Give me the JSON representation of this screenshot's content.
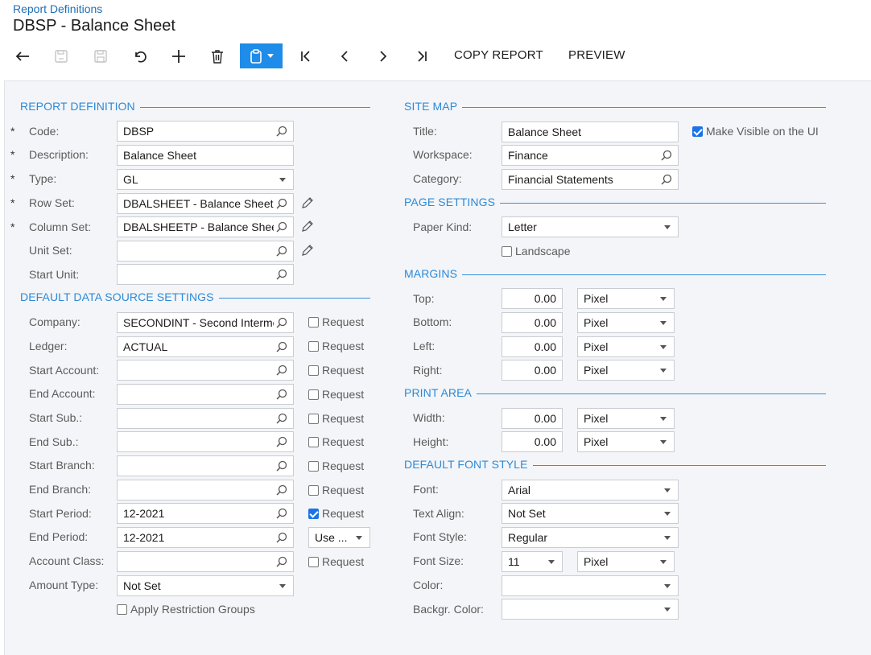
{
  "header": {
    "breadcrumb": "Report Definitions",
    "title": "DBSP - Balance Sheet"
  },
  "toolbar": {
    "copy_report": "COPY REPORT",
    "preview": "PREVIEW"
  },
  "sections": {
    "report_definition": "REPORT DEFINITION",
    "default_data_source": "DEFAULT DATA SOURCE SETTINGS",
    "site_map": "SITE MAP",
    "page_settings": "PAGE SETTINGS",
    "margins": "MARGINS",
    "print_area": "PRINT AREA",
    "default_font_style": "DEFAULT FONT STYLE"
  },
  "report_definition": {
    "code": {
      "label": "Code:",
      "value": "DBSP"
    },
    "description": {
      "label": "Description:",
      "value": "Balance Sheet"
    },
    "type": {
      "label": "Type:",
      "value": "GL"
    },
    "row_set": {
      "label": "Row Set:",
      "value": "DBALSHEET - Balance Sheet"
    },
    "column_set": {
      "label": "Column Set:",
      "value": "DBALSHEETP - Balance Sheet"
    },
    "unit_set": {
      "label": "Unit Set:",
      "value": ""
    },
    "start_unit": {
      "label": "Start Unit:",
      "value": ""
    }
  },
  "data_source": {
    "request_label": "Request",
    "company": {
      "label": "Company:",
      "value": "SECONDINT - Second Intermediate",
      "request": false
    },
    "ledger": {
      "label": "Ledger:",
      "value": "ACTUAL",
      "request": false
    },
    "start_account": {
      "label": "Start Account:",
      "value": "",
      "request": false
    },
    "end_account": {
      "label": "End Account:",
      "value": "",
      "request": false
    },
    "start_sub": {
      "label": "Start Sub.:",
      "value": "",
      "request": false
    },
    "end_sub": {
      "label": "End Sub.:",
      "value": "",
      "request": false
    },
    "start_branch": {
      "label": "Start Branch:",
      "value": "",
      "request": false
    },
    "end_branch": {
      "label": "End Branch:",
      "value": "",
      "request": false
    },
    "start_period": {
      "label": "Start Period:",
      "value": "12-2021",
      "request": true
    },
    "end_period": {
      "label": "End Period:",
      "value": "12-2021",
      "use_select": "Use ..."
    },
    "account_class": {
      "label": "Account Class:",
      "value": "",
      "request": false
    },
    "amount_type": {
      "label": "Amount Type:",
      "value": "Not Set"
    },
    "apply_restriction": "Apply Restriction Groups"
  },
  "site_map": {
    "title": {
      "label": "Title:",
      "value": "Balance Sheet"
    },
    "make_visible": "Make Visible on the UI",
    "workspace": {
      "label": "Workspace:",
      "value": "Finance"
    },
    "category": {
      "label": "Category:",
      "value": "Financial Statements"
    }
  },
  "page_settings": {
    "paper_kind": {
      "label": "Paper Kind:",
      "value": "Letter"
    },
    "landscape": "Landscape"
  },
  "margins": {
    "top": {
      "label": "Top:",
      "value": "0.00",
      "unit": "Pixel"
    },
    "bottom": {
      "label": "Bottom:",
      "value": "0.00",
      "unit": "Pixel"
    },
    "left": {
      "label": "Left:",
      "value": "0.00",
      "unit": "Pixel"
    },
    "right": {
      "label": "Right:",
      "value": "0.00",
      "unit": "Pixel"
    }
  },
  "print_area": {
    "width": {
      "label": "Width:",
      "value": "0.00",
      "unit": "Pixel"
    },
    "height": {
      "label": "Height:",
      "value": "0.00",
      "unit": "Pixel"
    }
  },
  "font_style": {
    "font": {
      "label": "Font:",
      "value": "Arial"
    },
    "text_align": {
      "label": "Text Align:",
      "value": "Not Set"
    },
    "font_style": {
      "label": "Font Style:",
      "value": "Regular"
    },
    "font_size": {
      "label": "Font Size:",
      "value": "11",
      "unit": "Pixel"
    },
    "color": {
      "label": "Color:",
      "value": ""
    },
    "backgr_color": {
      "label": "Backgr. Color:",
      "value": ""
    }
  },
  "colors": {
    "accent": "#1e8ce8",
    "section": "#2e89d6",
    "link": "#1f6fb5"
  }
}
